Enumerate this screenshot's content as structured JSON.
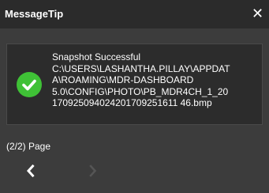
{
  "window": {
    "title": "MessageTip",
    "close_glyph": "✕"
  },
  "message": {
    "icon": "check-circle-icon",
    "icon_color": "#3fc136",
    "lines": [
      "Snapshot Successful",
      "C:\\USERS\\LASHANTHA.PILLAY\\APPDAT",
      "A\\ROAMING\\MDR-DASHBOARD",
      "5.0\\CONFIG\\PHOTO\\PB_MDR4CH_1_20",
      "170925094024201709251611 46.bmp"
    ]
  },
  "pager": {
    "label": "(2/2) Page",
    "prev_icon": "chevron-left-icon",
    "next_icon": "chevron-right-icon"
  }
}
